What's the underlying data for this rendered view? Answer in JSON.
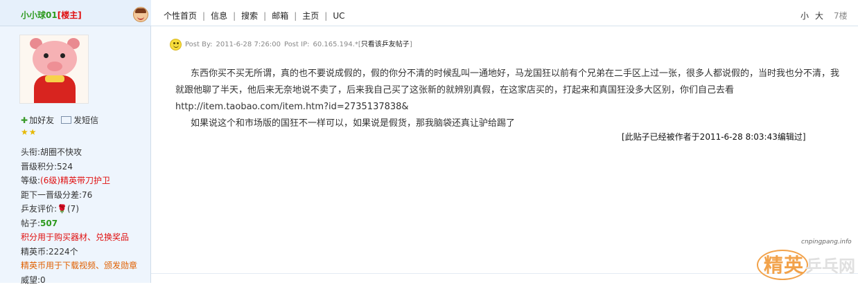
{
  "user": {
    "name": "小小球01",
    "owner_tag": "[楼主]",
    "add_friend": "加好友",
    "send_message": "发短信",
    "stars": "★★",
    "info": {
      "title_label": "头衔:",
      "title_value": "胡圈不快攻",
      "points_label": "晋级积分:",
      "points_value": "524",
      "level_label": "等级:",
      "level_value": "(6级)精英带刀护卫",
      "next_label": "距下一晋级分差:",
      "next_value": "76",
      "rating_label": "乒友评价:",
      "rating_value": "(7)",
      "posts_label": "帖子:",
      "posts_value": "507",
      "points_note": "积分用于购买器材、兑换奖品",
      "coins_label": "精英币:",
      "coins_value": "2224个",
      "coins_note": "精英币用于下载视频、颁发勋章",
      "prestige_label": "威望:",
      "prestige_value": "0"
    }
  },
  "menu": {
    "items": [
      "个性首页",
      "信息",
      "搜索",
      "邮箱",
      "主页",
      "UC"
    ],
    "size_small": "小",
    "size_large": "大",
    "floor": "7楼"
  },
  "post": {
    "post_by": "Post By:",
    "date": "2011-6-28 7:26:00",
    "post_ip": "Post IP:",
    "ip": "60.165.194.*",
    "only_author": "只看该乒友帖子",
    "paragraph1": "东西你买不买无所谓，真的也不要说成假的，假的你分不清的时候乱叫一通地好，马龙国狂以前有个兄弟在二手区上过一张，很多人都说假的，当时我也分不清，我就跟他聊了半天，他后来无奈地说不卖了，后来我自己买了这张新的就辨别真假，在这家店买的，打起来和真国狂没多大区别，你们自己去看http://item.taobao.com/item.htm?id=2735137838&",
    "paragraph2": "如果说这个和市场版的国狂不一样可以，如果说是假货，那我脑袋还真让驴给踢了",
    "edited_note": "[此贴子已经被作者于2011-6-28 8:03:43编辑过]"
  },
  "watermark": {
    "domain": "cnpingpang.info",
    "text1": "精英",
    "text2": "乒乓网"
  }
}
